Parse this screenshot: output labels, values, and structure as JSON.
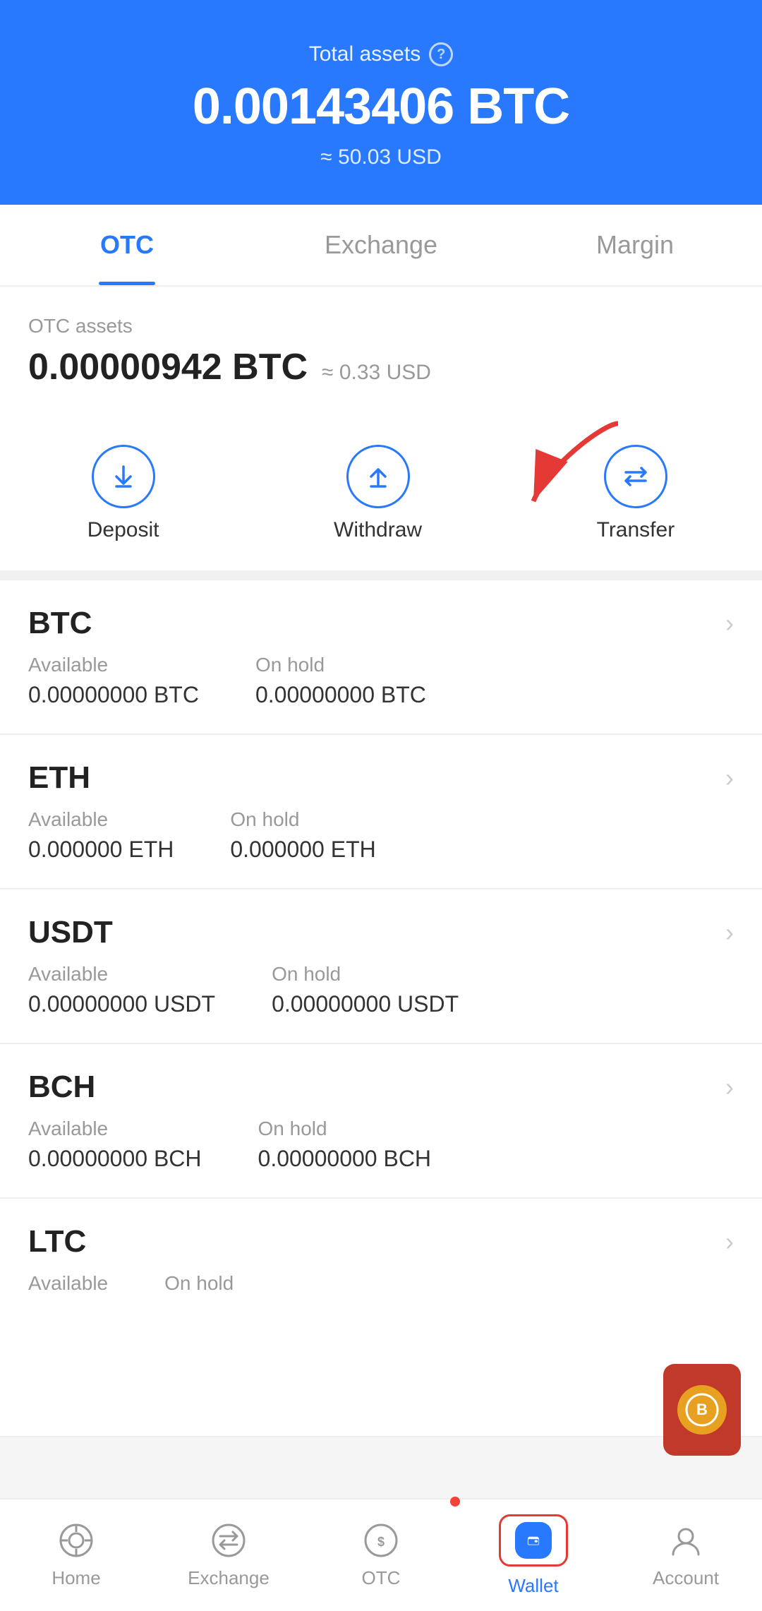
{
  "header": {
    "total_assets_label": "Total assets",
    "help_icon": "?",
    "total_btc": "0.00143406 BTC",
    "total_usd": "≈ 50.03 USD"
  },
  "tabs": [
    {
      "id": "otc",
      "label": "OTC",
      "active": true
    },
    {
      "id": "exchange",
      "label": "Exchange",
      "active": false
    },
    {
      "id": "margin",
      "label": "Margin",
      "active": false
    }
  ],
  "otc_section": {
    "assets_label": "OTC assets",
    "btc_value": "0.00000942 BTC",
    "usd_approx": "≈ 0.33 USD"
  },
  "actions": [
    {
      "id": "deposit",
      "label": "Deposit",
      "icon": "arrow-down"
    },
    {
      "id": "withdraw",
      "label": "Withdraw",
      "icon": "arrow-up"
    },
    {
      "id": "transfer",
      "label": "Transfer",
      "icon": "arrows-horizontal"
    }
  ],
  "assets": [
    {
      "name": "BTC",
      "available_label": "Available",
      "available_value": "0.00000000 BTC",
      "onhold_label": "On hold",
      "onhold_value": "0.00000000 BTC"
    },
    {
      "name": "ETH",
      "available_label": "Available",
      "available_value": "0.000000 ETH",
      "onhold_label": "On hold",
      "onhold_value": "0.000000 ETH"
    },
    {
      "name": "USDT",
      "available_label": "Available",
      "available_value": "0.00000000 USDT",
      "onhold_label": "On hold",
      "onhold_value": "0.00000000 USDT"
    },
    {
      "name": "BCH",
      "available_label": "Available",
      "available_value": "0.00000000 BCH",
      "onhold_label": "On hold",
      "onhold_value": "0.00000000 BCH"
    },
    {
      "name": "LTC",
      "available_label": "Available",
      "available_value": "",
      "onhold_label": "On hold",
      "onhold_value": ""
    }
  ],
  "bottom_nav": [
    {
      "id": "home",
      "label": "Home",
      "active": false
    },
    {
      "id": "exchange",
      "label": "Exchange",
      "active": false
    },
    {
      "id": "otc",
      "label": "OTC",
      "active": false,
      "badge": true
    },
    {
      "id": "wallet",
      "label": "Wallet",
      "active": true
    },
    {
      "id": "account",
      "label": "Account",
      "active": false
    }
  ],
  "colors": {
    "primary": "#2979ff",
    "active_tab": "#2979ff",
    "inactive_tab": "#999999",
    "text_dark": "#222222",
    "text_muted": "#999999"
  }
}
